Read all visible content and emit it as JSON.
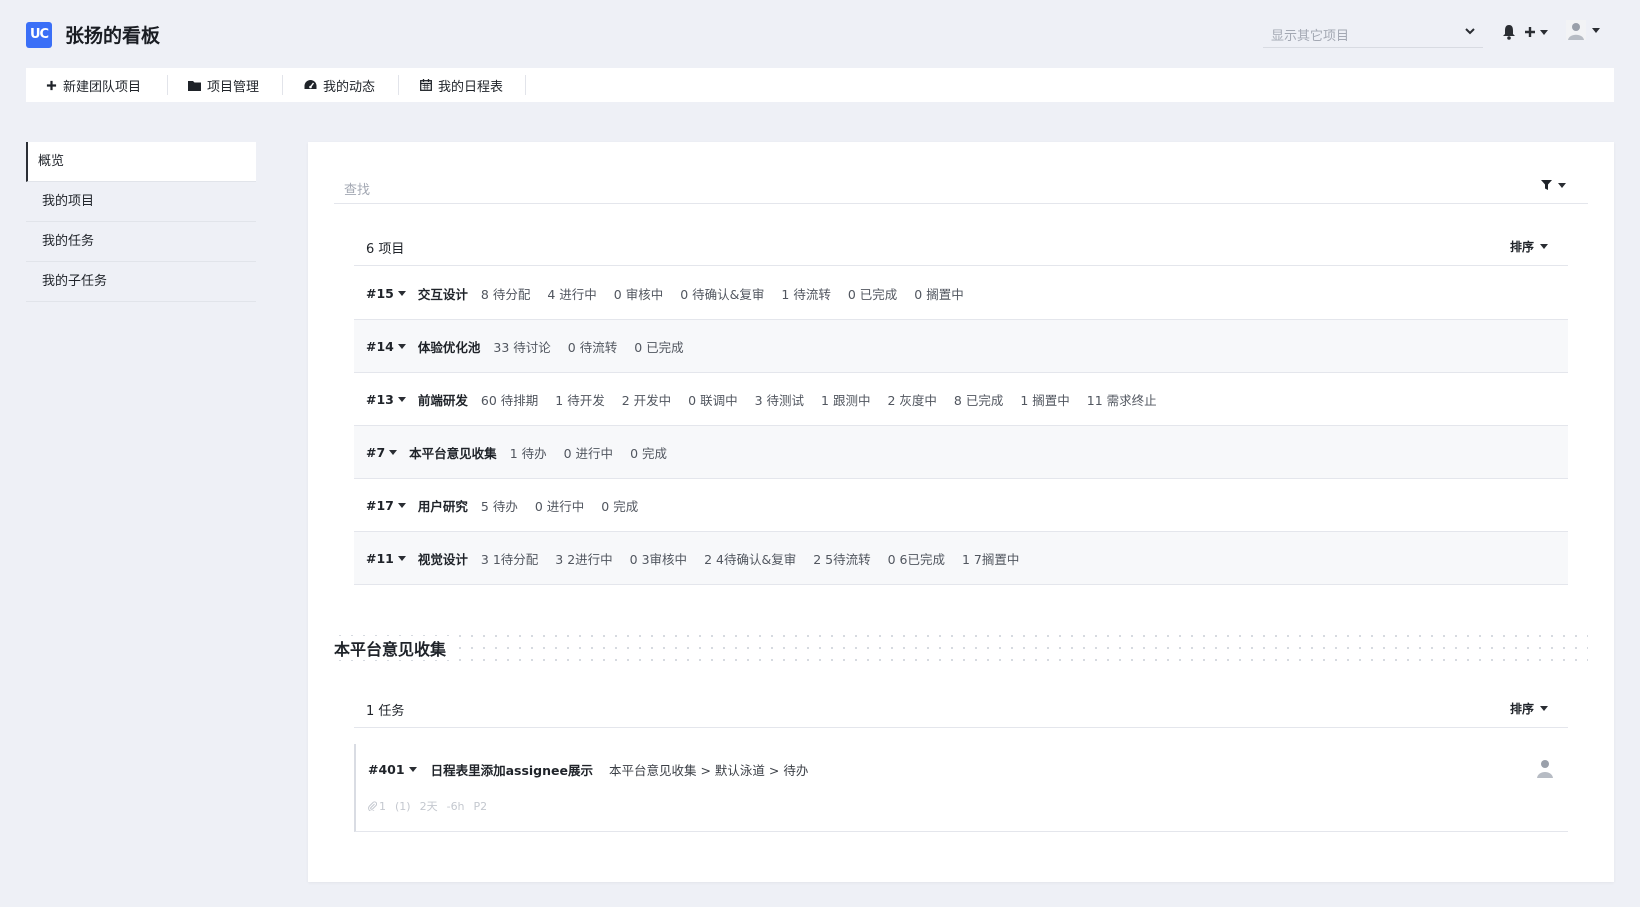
{
  "header": {
    "logo_text": "UC",
    "title": "张扬的看板",
    "project_select_placeholder": "显示其它项目"
  },
  "topnav": {
    "items": [
      {
        "label": "新建团队项目",
        "icon": "plus-icon"
      },
      {
        "label": "项目管理",
        "icon": "folder-icon"
      },
      {
        "label": "我的动态",
        "icon": "dashboard-icon"
      },
      {
        "label": "我的日程表",
        "icon": "calendar-icon"
      }
    ]
  },
  "sidebar": {
    "items": [
      {
        "label": "概览",
        "active": true
      },
      {
        "label": "我的项目",
        "active": false
      },
      {
        "label": "我的任务",
        "active": false
      },
      {
        "label": "我的子任务",
        "active": false
      }
    ]
  },
  "main": {
    "search_placeholder": "查找",
    "projects": {
      "count_label": "6 项目",
      "sort_label": "排序",
      "rows": [
        {
          "id": "#15",
          "name": "交互设计",
          "stats": [
            "8 待分配",
            "4 进行中",
            "0 审核中",
            "0 待确认&复审",
            "1 待流转",
            "0 已完成",
            "0 搁置中"
          ]
        },
        {
          "id": "#14",
          "name": "体验优化池",
          "stats": [
            "33 待讨论",
            "0 待流转",
            "0 已完成"
          ]
        },
        {
          "id": "#13",
          "name": "前端研发",
          "stats": [
            "60 待排期",
            "1 待开发",
            "2 开发中",
            "0 联调中",
            "3 待测试",
            "1 跟测中",
            "2 灰度中",
            "8 已完成",
            "1 搁置中",
            "11 需求终止"
          ]
        },
        {
          "id": "#7",
          "name": "本平台意见收集",
          "stats": [
            "1 待办",
            "0 进行中",
            "0 完成"
          ]
        },
        {
          "id": "#17",
          "name": "用户研究",
          "stats": [
            "5 待办",
            "0 进行中",
            "0 完成"
          ]
        },
        {
          "id": "#11",
          "name": "视觉设计",
          "stats": [
            "3 1待分配",
            "3 2进行中",
            "0 3审核中",
            "2 4待确认&复审",
            "2 5待流转",
            "0 6已完成",
            "1 7搁置中"
          ]
        }
      ]
    },
    "section": {
      "title": "本平台意见收集",
      "count_label": "1 任务",
      "sort_label": "排序",
      "task": {
        "id": "#401",
        "title": "日程表里添加assignee展示",
        "path": "本平台意见收集 > 默认泳道 > 待办",
        "meta": [
          "1",
          "(1)",
          "2天",
          "-6h",
          "P2"
        ]
      }
    }
  }
}
